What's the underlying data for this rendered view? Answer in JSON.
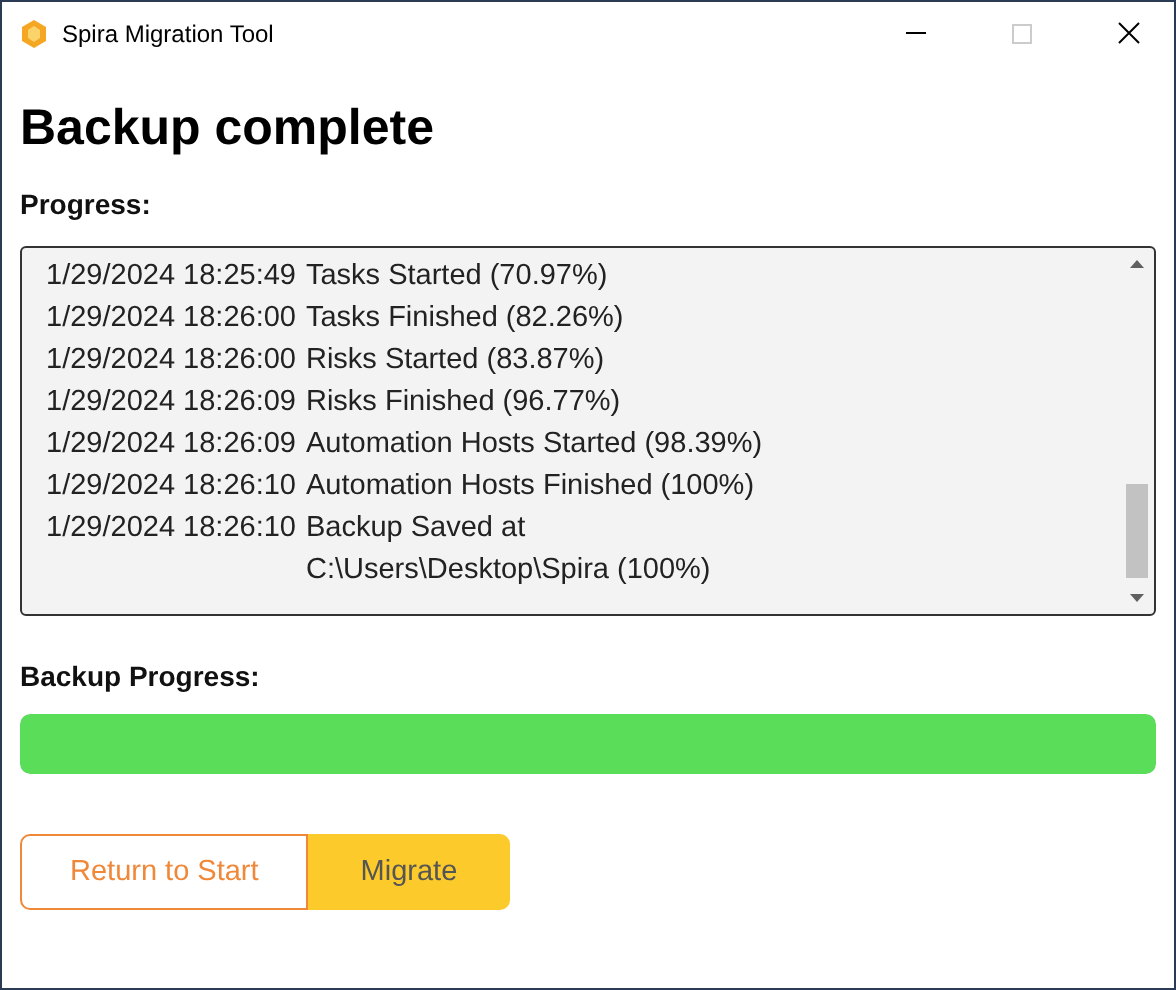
{
  "window": {
    "title": "Spira Migration Tool"
  },
  "heading": "Backup complete",
  "progress_label": "Progress:",
  "log": [
    {
      "time": "1/29/2024 18:25:49",
      "lines": [
        "Tasks Started (70.97%)"
      ]
    },
    {
      "time": "1/29/2024 18:26:00",
      "lines": [
        "Tasks Finished (82.26%)"
      ]
    },
    {
      "time": "1/29/2024 18:26:00",
      "lines": [
        "Risks Started (83.87%)"
      ]
    },
    {
      "time": "1/29/2024 18:26:09",
      "lines": [
        "Risks Finished (96.77%)"
      ]
    },
    {
      "time": "1/29/2024 18:26:09",
      "lines": [
        "Automation Hosts Started (98.39%)"
      ]
    },
    {
      "time": "1/29/2024 18:26:10",
      "lines": [
        "Automation Hosts Finished (100%)"
      ]
    },
    {
      "time": "1/29/2024 18:26:10",
      "lines": [
        "Backup Saved at",
        "C:\\Users\\Desktop\\Spira (100%)"
      ]
    }
  ],
  "backup_progress": {
    "label": "Backup Progress:",
    "level": 1
  },
  "buttons": [
    {
      "label": "Return to Start",
      "kind": "outline"
    },
    {
      "label": "Migrate",
      "kind": "filled"
    }
  ]
}
